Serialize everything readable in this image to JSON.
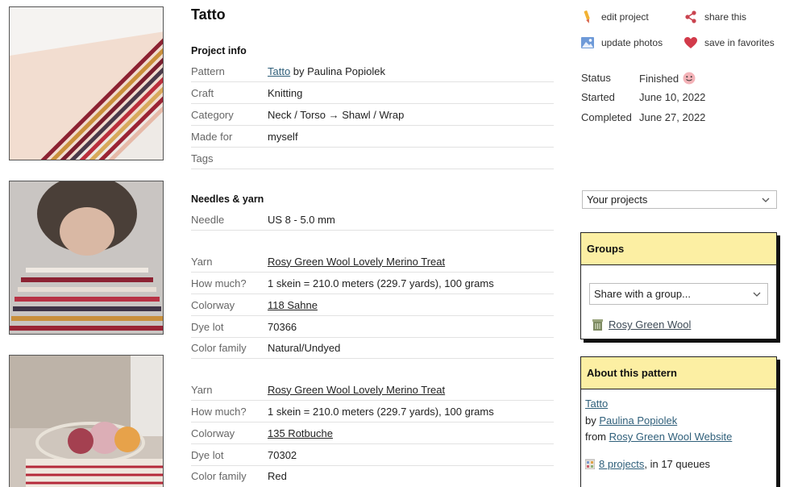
{
  "project": {
    "title": "Tatto"
  },
  "project_info": {
    "heading": "Project info",
    "rows": [
      {
        "label": "Pattern",
        "link": "Tatto",
        "text": " by Paulina Popiolek"
      },
      {
        "label": "Craft",
        "value": "Knitting"
      },
      {
        "label": "Category",
        "value": "Neck / Torso → Shawl / Wrap"
      },
      {
        "label": "Made for",
        "value": "myself"
      },
      {
        "label": "Tags",
        "value": ""
      }
    ]
  },
  "needles_yarn": {
    "heading": "Needles & yarn",
    "needle": {
      "label": "Needle",
      "value": "US 8 - 5.0 mm"
    },
    "yarns": [
      {
        "yarn_label": "Yarn",
        "yarn": "Rosy Green Wool Lovely Merino Treat",
        "amount_label": "How much?",
        "amount": "1 skein = 210.0 meters (229.7 yards), 100 grams",
        "colorway_label": "Colorway",
        "colorway": "118 Sahne",
        "dyelot_label": "Dye lot",
        "dyelot": "70366",
        "family_label": "Color family",
        "family": "Natural/Undyed"
      },
      {
        "yarn_label": "Yarn",
        "yarn": "Rosy Green Wool Lovely Merino Treat",
        "amount_label": "How much?",
        "amount": "1 skein = 210.0 meters (229.7 yards), 100 grams",
        "colorway_label": "Colorway",
        "colorway": "135 Rotbuche",
        "dyelot_label": "Dye lot",
        "dyelot": "70302",
        "family_label": "Color family",
        "family": "Red"
      }
    ]
  },
  "actions": {
    "edit": "edit project",
    "share": "share this",
    "update_photos": "update photos",
    "favorite": "save in favorites"
  },
  "status": {
    "status_label": "Status",
    "status_value": "Finished",
    "started_label": "Started",
    "started_value": "June 10, 2022",
    "completed_label": "Completed",
    "completed_value": "June 27, 2022"
  },
  "projects_select": {
    "value": "Your projects"
  },
  "groups": {
    "heading": "Groups",
    "select_value": "Share with a group...",
    "group": "Rosy Green Wool"
  },
  "about_pattern": {
    "heading": "About this pattern",
    "pattern_name": "Tatto",
    "by_prefix": "by ",
    "designer": "Paulina Popiolek",
    "from_prefix": "from ",
    "source": "Rosy Green Wool Website",
    "projects_link": "8 projects",
    "queues_text": ", in 17 queues"
  },
  "icons": [
    "pencil-icon",
    "share-icon",
    "photos-icon",
    "heart-icon",
    "finished-face-icon",
    "chevron-down-icon",
    "group-badge-icon",
    "projects-icon"
  ]
}
